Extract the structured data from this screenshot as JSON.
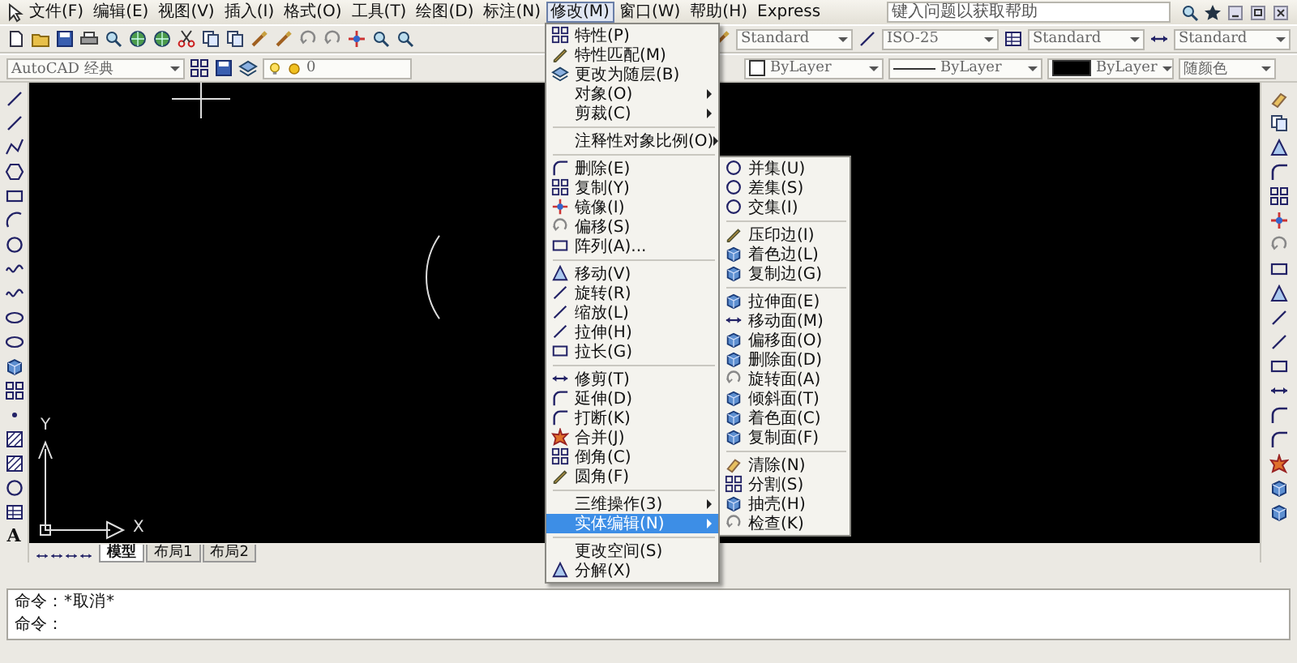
{
  "menubar": {
    "items": [
      {
        "label": "文件(F)",
        "selected": false
      },
      {
        "label": "编辑(E)",
        "selected": false
      },
      {
        "label": "视图(V)",
        "selected": false
      },
      {
        "label": "插入(I)",
        "selected": false
      },
      {
        "label": "格式(O)",
        "selected": false
      },
      {
        "label": "工具(T)",
        "selected": false
      },
      {
        "label": "绘图(D)",
        "selected": false
      },
      {
        "label": "标注(N)",
        "selected": false
      },
      {
        "label": "修改(M)",
        "selected": true
      },
      {
        "label": "窗口(W)",
        "selected": false
      },
      {
        "label": "帮助(H)",
        "selected": false
      },
      {
        "label": "Express",
        "selected": false
      }
    ],
    "help_search": {
      "placeholder": "键入问题以获取帮助"
    }
  },
  "style_toolbar": [
    {
      "value": "Standard"
    },
    {
      "value": "ISO-25"
    },
    {
      "value": "Standard"
    },
    {
      "value": "Standard"
    }
  ],
  "workspace": {
    "value": "AutoCAD 经典"
  },
  "layer": {
    "value": "0"
  },
  "properties": [
    {
      "kind": "color",
      "value": "ByLayer"
    },
    {
      "kind": "linetype",
      "value": "ByLayer"
    },
    {
      "kind": "lineweight",
      "value": "ByLayer"
    },
    {
      "kind": "plotstyle",
      "value": "随颜色"
    }
  ],
  "modify_menu": {
    "items": [
      {
        "kind": "icon",
        "label": "特性(P)",
        "selected": false
      },
      {
        "kind": "icon",
        "label": "特性匹配(M)",
        "selected": false
      },
      {
        "kind": "icon",
        "label": "更改为随层(B)",
        "selected": false
      },
      {
        "kind": "submenu",
        "label": "对象(O)",
        "selected": false
      },
      {
        "kind": "submenu",
        "label": "剪裁(C)",
        "selected": false
      },
      {
        "kind": "separator"
      },
      {
        "kind": "submenu",
        "label": "注释性对象比例(O)",
        "selected": false
      },
      {
        "kind": "separator"
      },
      {
        "kind": "icon",
        "label": "删除(E)",
        "selected": false
      },
      {
        "kind": "icon",
        "label": "复制(Y)",
        "selected": false
      },
      {
        "kind": "icon",
        "label": "镜像(I)",
        "selected": false
      },
      {
        "kind": "icon",
        "label": "偏移(S)",
        "selected": false
      },
      {
        "kind": "icon",
        "label": "阵列(A)...",
        "selected": false
      },
      {
        "kind": "separator"
      },
      {
        "kind": "icon",
        "label": "移动(V)",
        "selected": false
      },
      {
        "kind": "icon",
        "label": "旋转(R)",
        "selected": false
      },
      {
        "kind": "icon",
        "label": "缩放(L)",
        "selected": false
      },
      {
        "kind": "icon",
        "label": "拉伸(H)",
        "selected": false
      },
      {
        "kind": "icon",
        "label": "拉长(G)",
        "selected": false
      },
      {
        "kind": "separator"
      },
      {
        "kind": "icon",
        "label": "修剪(T)",
        "selected": false
      },
      {
        "kind": "icon",
        "label": "延伸(D)",
        "selected": false
      },
      {
        "kind": "icon",
        "label": "打断(K)",
        "selected": false
      },
      {
        "kind": "icon",
        "label": "合并(J)",
        "selected": false
      },
      {
        "kind": "icon",
        "label": "倒角(C)",
        "selected": false
      },
      {
        "kind": "icon",
        "label": "圆角(F)",
        "selected": false
      },
      {
        "kind": "separator"
      },
      {
        "kind": "submenu",
        "label": "三维操作(3)",
        "selected": false
      },
      {
        "kind": "submenu",
        "label": "实体编辑(N)",
        "selected": true
      },
      {
        "kind": "separator"
      },
      {
        "kind": "plain",
        "label": "更改空间(S)",
        "selected": false
      },
      {
        "kind": "icon",
        "label": "分解(X)",
        "selected": false
      }
    ]
  },
  "solid_edit_submenu": {
    "items": [
      {
        "kind": "icon",
        "label": "并集(U)",
        "selected": false
      },
      {
        "kind": "icon",
        "label": "差集(S)",
        "selected": false
      },
      {
        "kind": "icon",
        "label": "交集(I)",
        "selected": false
      },
      {
        "kind": "separator"
      },
      {
        "kind": "icon",
        "label": "压印边(I)",
        "selected": false
      },
      {
        "kind": "icon",
        "label": "着色边(L)",
        "selected": false
      },
      {
        "kind": "icon",
        "label": "复制边(G)",
        "selected": false
      },
      {
        "kind": "separator"
      },
      {
        "kind": "icon",
        "label": "拉伸面(E)",
        "selected": false
      },
      {
        "kind": "icon",
        "label": "移动面(M)",
        "selected": false
      },
      {
        "kind": "icon",
        "label": "偏移面(O)",
        "selected": false
      },
      {
        "kind": "icon",
        "label": "删除面(D)",
        "selected": false
      },
      {
        "kind": "icon",
        "label": "旋转面(A)",
        "selected": false
      },
      {
        "kind": "icon",
        "label": "倾斜面(T)",
        "selected": false
      },
      {
        "kind": "icon",
        "label": "着色面(C)",
        "selected": false
      },
      {
        "kind": "icon",
        "label": "复制面(F)",
        "selected": false
      },
      {
        "kind": "separator"
      },
      {
        "kind": "icon",
        "label": "清除(N)",
        "selected": false
      },
      {
        "kind": "icon",
        "label": "分割(S)",
        "selected": false
      },
      {
        "kind": "icon",
        "label": "抽壳(H)",
        "selected": false
      },
      {
        "kind": "icon",
        "label": "检查(K)",
        "selected": false
      }
    ]
  },
  "left_toolbar": {
    "text_tool": "A"
  },
  "canvas": {
    "y_axis": "Y",
    "x_axis": "X"
  },
  "layout_tabs": [
    {
      "label": "模型",
      "selected": true
    },
    {
      "label": "布局1",
      "selected": false
    },
    {
      "label": "布局2",
      "selected": false
    }
  ],
  "command_lines": [
    "命令：*取消*",
    "命令："
  ]
}
